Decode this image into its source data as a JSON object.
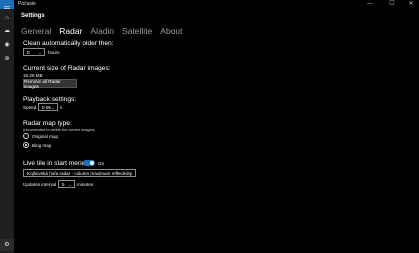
{
  "window": {
    "title": "Počasie",
    "minimize_glyph": "—",
    "maximize_glyph": "☐",
    "close_glyph": "✕"
  },
  "rail": {
    "menu_icon": "hamburger-menu-icon",
    "items": [
      {
        "icon": "home-icon",
        "glyph": "⌂"
      },
      {
        "icon": "weather-icon",
        "glyph": "☁"
      },
      {
        "icon": "radar-icon",
        "glyph": "◉"
      },
      {
        "icon": "globe-icon",
        "glyph": "⊕"
      }
    ],
    "settings_icon": "gear-icon",
    "settings_glyph": "⚙"
  },
  "page": {
    "title": "Settings",
    "tabs": [
      {
        "label": "General"
      },
      {
        "label": "Radar"
      },
      {
        "label": "Aladin"
      },
      {
        "label": "Satellite"
      },
      {
        "label": "About"
      }
    ],
    "active_tab": "Radar"
  },
  "clean": {
    "heading": "Clean automatically older then:",
    "value": "0",
    "unit": "hours"
  },
  "size": {
    "heading": "Current size of Radar images:",
    "value": "15.26 MB",
    "remove_button": "Remove all Radar images"
  },
  "playback": {
    "heading": "Playback settings:",
    "speed_label": "Speed",
    "speed_value": "0.05",
    "speed_unit": "s"
  },
  "maptype": {
    "heading": "Radar map type:",
    "note": "(recomended to delete the current images)",
    "options": [
      {
        "label": "Original map",
        "checked": false
      },
      {
        "label": "Bing map",
        "checked": true
      }
    ]
  },
  "livetile": {
    "heading": "Live tile in start menu",
    "toggle_state": "On",
    "source_value": "Kojšovská hoľa radar - column maximum reflectivity",
    "interval_label": "Updates interval",
    "interval_value": "5",
    "interval_unit": "minutes"
  },
  "colors": {
    "accent": "#1d6fb8",
    "background": "#000000",
    "rail": "#1f1f1f"
  }
}
